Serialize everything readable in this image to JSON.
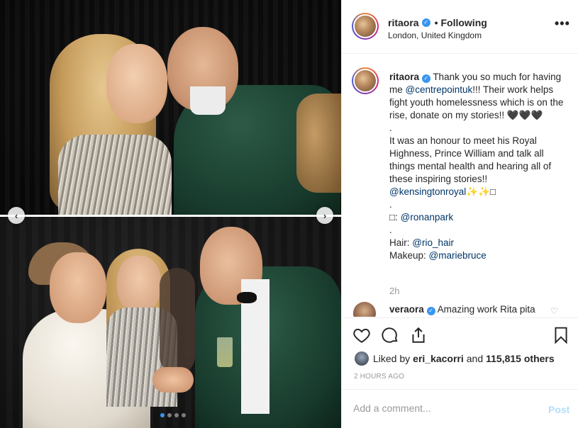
{
  "header": {
    "username": "ritaora",
    "verified": true,
    "separator": "•",
    "follow_label": "Following",
    "location": "London, United Kingdom",
    "more_icon": "more-horizontal-icon",
    "more_label": "•••"
  },
  "caption": {
    "username": "ritaora",
    "lines": [
      "Thank you so much for having me ",
      "!!! Their work helps fight youth homelessness which is on the rise, donate on my stories!! 🖤🖤🖤",
      ".",
      "It was an honour to meet his Royal Highness, Prince William and talk all things mental health and hearing all of these inspiring stories!!",
      "✨✨□",
      ".",
      ".",
      "□: ",
      ".",
      "Hair: ",
      "Makeup: "
    ],
    "mentions": {
      "centrepoint": "@centrepointuk",
      "kensington": "@kensingtonroyal",
      "ronan": "@ronanpark",
      "rio": "@rio_hair",
      "marie": "@mariebruce"
    },
    "time_ago": "2h"
  },
  "comment": {
    "username": "veraora",
    "verified": true,
    "text": "Amazing work Rita pita",
    "heart_icon": "heart-outline-icon",
    "heart_label": "♡"
  },
  "actions": {
    "like_icon": "heart-icon",
    "comment_icon": "comment-icon",
    "share_icon": "share-icon",
    "save_icon": "bookmark-icon"
  },
  "likes": {
    "prefix": "Liked by",
    "user": "eri_kacorri",
    "joiner": "and",
    "count": "115,815 others"
  },
  "timestamp": "2 HOURS AGO",
  "add_comment": {
    "placeholder": "Add a comment...",
    "post_label": "Post"
  },
  "carousel": {
    "prev_label": "‹",
    "next_label": "›",
    "current_index": 1,
    "total": 4
  },
  "colors": {
    "accent": "#3897f0",
    "link": "#003569",
    "muted": "#999999",
    "post_disabled": "#b2dffc"
  }
}
